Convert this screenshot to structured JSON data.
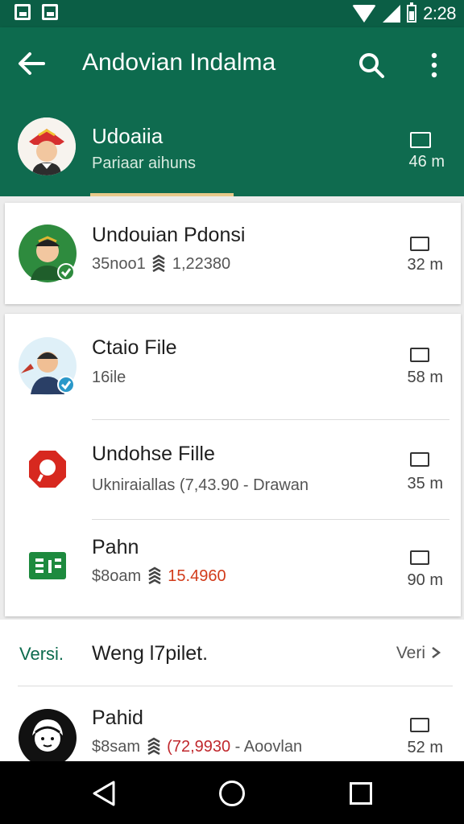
{
  "status_bar": {
    "time": "2:28"
  },
  "app_bar": {
    "title": "Andovian Indalma"
  },
  "profile": {
    "name": "Udoaiia",
    "subtitle": "Pariaar aihuns",
    "time": "46 m"
  },
  "card1": {
    "title": "Undouian Pdonsi",
    "sub_prefix": "35noo1 ",
    "sub_value": "1,22380",
    "time": "32 m"
  },
  "card2": {
    "rows": [
      {
        "title": "Ctaio File",
        "sub": "16ile",
        "time": "58 m"
      },
      {
        "title": "Undohse Fille",
        "sub": "Ukniraiallas (7,43.90 - Drawan",
        "time": "35 m"
      },
      {
        "title": "Pahn",
        "sub_prefix": "$8oam ",
        "sub_value": "15.4960",
        "time": "90 m"
      }
    ]
  },
  "section": {
    "left_label": "Versi.",
    "title": "Weng l7pilet.",
    "right_label": "Veri",
    "row": {
      "title": "Pahid",
      "sub_prefix": "$8sam ",
      "sub_value": "(72,9930",
      "sub_suffix": " - Aoovlan",
      "time": "52 m"
    }
  },
  "colors": {
    "brand_green": "#0d6b4e",
    "accent_red": "#d23b1a"
  }
}
